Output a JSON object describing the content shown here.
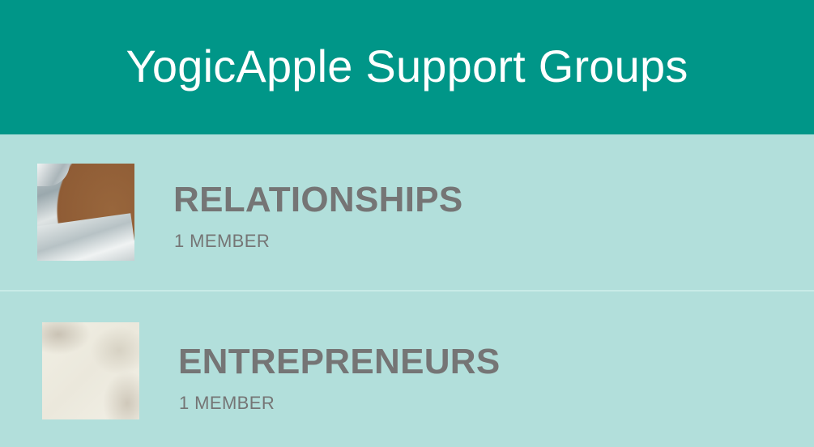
{
  "app_bar": {
    "title": "YogicApple Support Groups",
    "color": "#009688"
  },
  "list": {
    "background": "#b2dfdb",
    "groups": [
      {
        "name": "RELATIONSHIPS",
        "members": "1 MEMBER",
        "thumbnail": "group-photo"
      },
      {
        "name": "ENTREPRENEURS",
        "members": "1 MEMBER",
        "thumbnail": "group-photo"
      }
    ]
  }
}
